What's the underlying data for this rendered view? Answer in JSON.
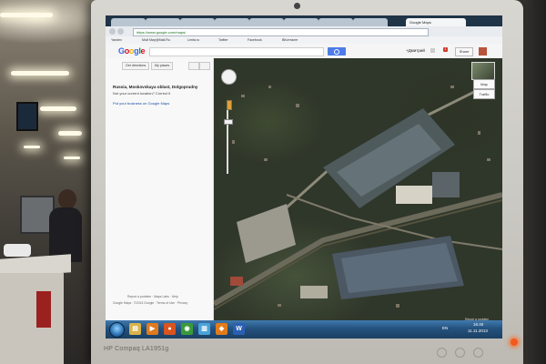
{
  "browser": {
    "tabs": [
      {
        "label": "Google Maps",
        "active": true
      }
    ],
    "url": "https://www.google.com/maps/",
    "bookmarks": [
      "Yandex",
      "Мой Мир@Mail.Ru",
      "Lenta.ru",
      "Twitter",
      "Facebook",
      "ВКонтакте"
    ]
  },
  "google": {
    "logo_letters": [
      {
        "ch": "G",
        "color": "#3369e8"
      },
      {
        "ch": "o",
        "color": "#d50f25"
      },
      {
        "ch": "o",
        "color": "#eeb211"
      },
      {
        "ch": "g",
        "color": "#3369e8"
      },
      {
        "ch": "l",
        "color": "#009925"
      },
      {
        "ch": "e",
        "color": "#d50f25"
      }
    ],
    "user": "+Дмитрий",
    "share": "Share",
    "notifications": "1"
  },
  "panel": {
    "buttons": [
      "Get directions",
      "My places"
    ],
    "place_title": "Russia, Moskovskaya oblast, Dolgoprudny",
    "place_sub": "Not your current location? Correct it",
    "place_link": "Put your business on Google Maps",
    "footer1": "Report a problem · Maps Labs · Help",
    "footer2": "Google Maps · ©2013 Google · Terms of Use · Privacy"
  },
  "map": {
    "type_buttons": [
      "Map",
      "Traffic"
    ],
    "footer": "Report a problem"
  },
  "taskbar": {
    "icons": [
      {
        "name": "explorer",
        "glyph": "▤",
        "bg": "#d9b34a"
      },
      {
        "name": "media-player",
        "glyph": "▶",
        "bg": "#e07a1f"
      },
      {
        "name": "firefox",
        "glyph": "●",
        "bg": "#d9541e"
      },
      {
        "name": "chrome",
        "glyph": "◉",
        "bg": "#3a9a3a"
      },
      {
        "name": "notepad",
        "glyph": "▥",
        "bg": "#4aa3d9"
      },
      {
        "name": "office",
        "glyph": "◆",
        "bg": "#e27b1c"
      },
      {
        "name": "word",
        "glyph": "W",
        "bg": "#2b5fb3"
      }
    ],
    "lang": "EN",
    "time": "16:40",
    "date": "11.11.2013"
  },
  "monitor": {
    "brand": "HP Compaq LA1951g"
  }
}
